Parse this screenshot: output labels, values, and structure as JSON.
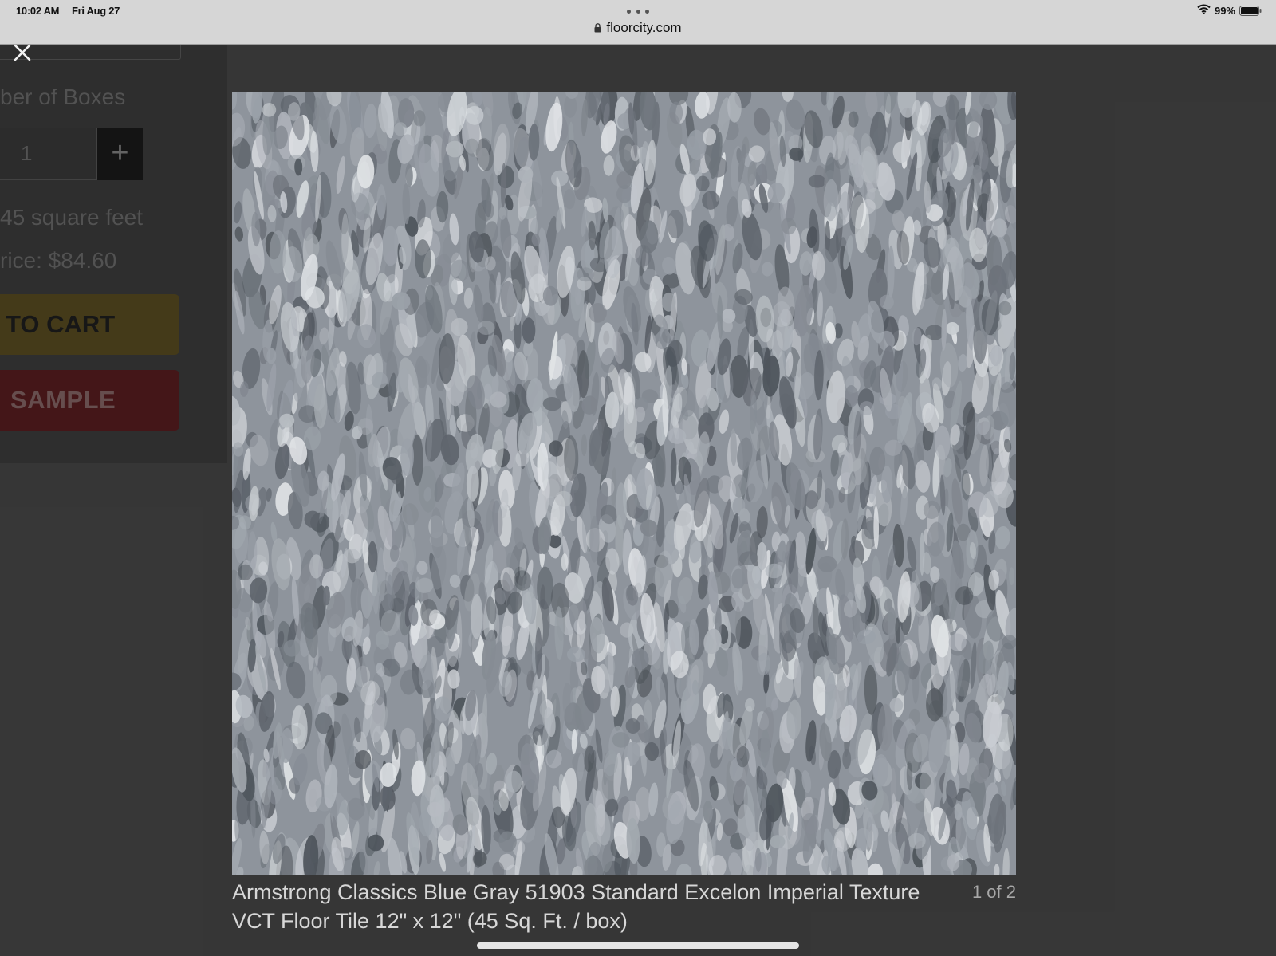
{
  "status_bar": {
    "time": "10:02 AM",
    "date": "Fri Aug 27",
    "url": "floorcity.com",
    "battery": "99%"
  },
  "background_page": {
    "boxes_label": "ber of Boxes",
    "quantity": "1",
    "plus_label": "+",
    "square_feet": "45 square feet",
    "price": "rice: $84.60",
    "add_to_cart_label": "TO CART",
    "sample_label": "SAMPLE"
  },
  "lightbox": {
    "caption": "Armstrong Classics Blue Gray 51903 Standard Excelon Imperial Texture VCT Floor Tile 12\" x 12\" (45 Sq. Ft. / box)",
    "counter": "1 of 2"
  },
  "colors": {
    "add_to_cart": "#4c3f13",
    "sample": "#4d0f12",
    "tile_base": "#8e949c"
  },
  "icons": {
    "close": "close-icon",
    "lock": "lock-icon",
    "wifi": "wifi-icon",
    "battery": "battery-icon",
    "more": "more-dots-icon"
  }
}
